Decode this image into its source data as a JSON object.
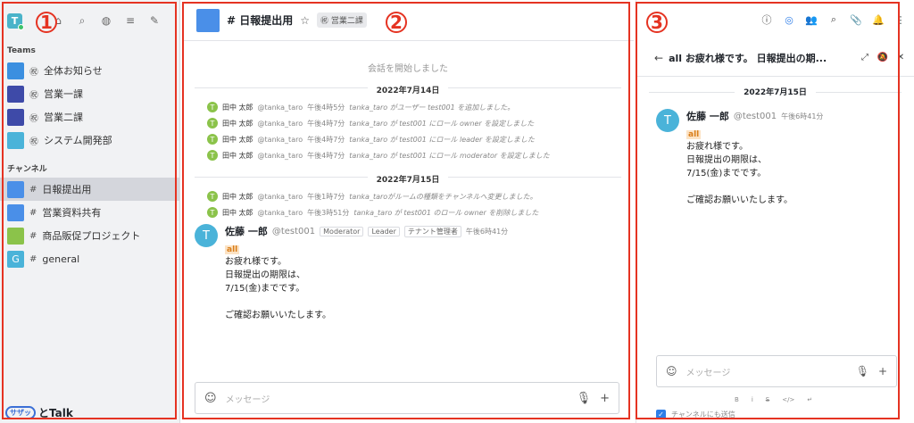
{
  "annotations": {
    "one": "1",
    "two": "2",
    "three": "3"
  },
  "sidebar": {
    "logo_letter": "T",
    "teams_label": "Teams",
    "teams": [
      {
        "prefix": "㊗",
        "label": "全体お知らせ",
        "color": "#3b8fe0"
      },
      {
        "prefix": "㊗",
        "label": "営業一課",
        "color": "#3e4aa8"
      },
      {
        "prefix": "㊗",
        "label": "営業二課",
        "color": "#3e4aa8"
      },
      {
        "prefix": "㊗",
        "label": "システム開発部",
        "color": "#4ab3d9"
      }
    ],
    "channels_label": "チャンネル",
    "channels": [
      {
        "prefix": "#",
        "label": "日報提出用",
        "color": "#4a8fe8",
        "letter": ""
      },
      {
        "prefix": "#",
        "label": "営業資料共有",
        "color": "#4a8fe8",
        "letter": ""
      },
      {
        "prefix": "#",
        "label": "商品販促プロジェクト",
        "color": "#8bc34a",
        "letter": ""
      },
      {
        "prefix": "#",
        "label": "general",
        "color": "#4ab3d9",
        "letter": "G"
      }
    ],
    "footer_pill": "サザッ",
    "footer_text": "とTalk"
  },
  "main": {
    "channel_title": "# 日報提出用",
    "star": "☆",
    "team_tag": "営業二課",
    "start_text": "会話を開始しました",
    "date1": "2022年7月14日",
    "date2": "2022年7月15日",
    "sys_msgs_1": [
      {
        "name": "田中 太郎",
        "uid": "@tanka_taro",
        "time": "午後4時5分",
        "text": "tanka_taro がユーザー test001 を追加しました。"
      },
      {
        "name": "田中 太郎",
        "uid": "@tanka_taro",
        "time": "午後4時7分",
        "text": "tanka_taro が test001 にロール owner を設定しました"
      },
      {
        "name": "田中 太郎",
        "uid": "@tanka_taro",
        "time": "午後4時7分",
        "text": "tanka_taro が test001 にロール leader を設定しました"
      },
      {
        "name": "田中 太郎",
        "uid": "@tanka_taro",
        "time": "午後4時7分",
        "text": "tanka_taro が test001 にロール moderator を設定しました"
      }
    ],
    "sys_msgs_2": [
      {
        "name": "田中 太郎",
        "uid": "@tanka_taro",
        "time": "午後1時7分",
        "text": "tanka_taroがルームの種類をチャンネルへ変更しました。"
      },
      {
        "name": "田中 太郎",
        "uid": "@tanka_taro",
        "time": "午後3時51分",
        "text": "tanka_taro が test001 のロール owner を削除しました"
      }
    ],
    "post": {
      "name": "佐藤 一郎",
      "uid": "@test001",
      "roles": [
        "Moderator",
        "Leader",
        "テナント管理者"
      ],
      "time": "午後6時41分",
      "mention": "all",
      "lines": [
        "お疲れ様です。",
        "日報提出の期限は、",
        "7/15(金)までです。",
        "",
        "ご確認お願いいたします。"
      ]
    },
    "input_placeholder": "メッセージ"
  },
  "thread": {
    "title": "all お疲れ様です。 日報提出の期...",
    "date": "2022年7月15日",
    "input_placeholder": "メッセージ",
    "format_items": [
      "B",
      "i",
      "S",
      "</>",
      "↵"
    ],
    "checkbox_label": "チャンネルにも送信"
  }
}
